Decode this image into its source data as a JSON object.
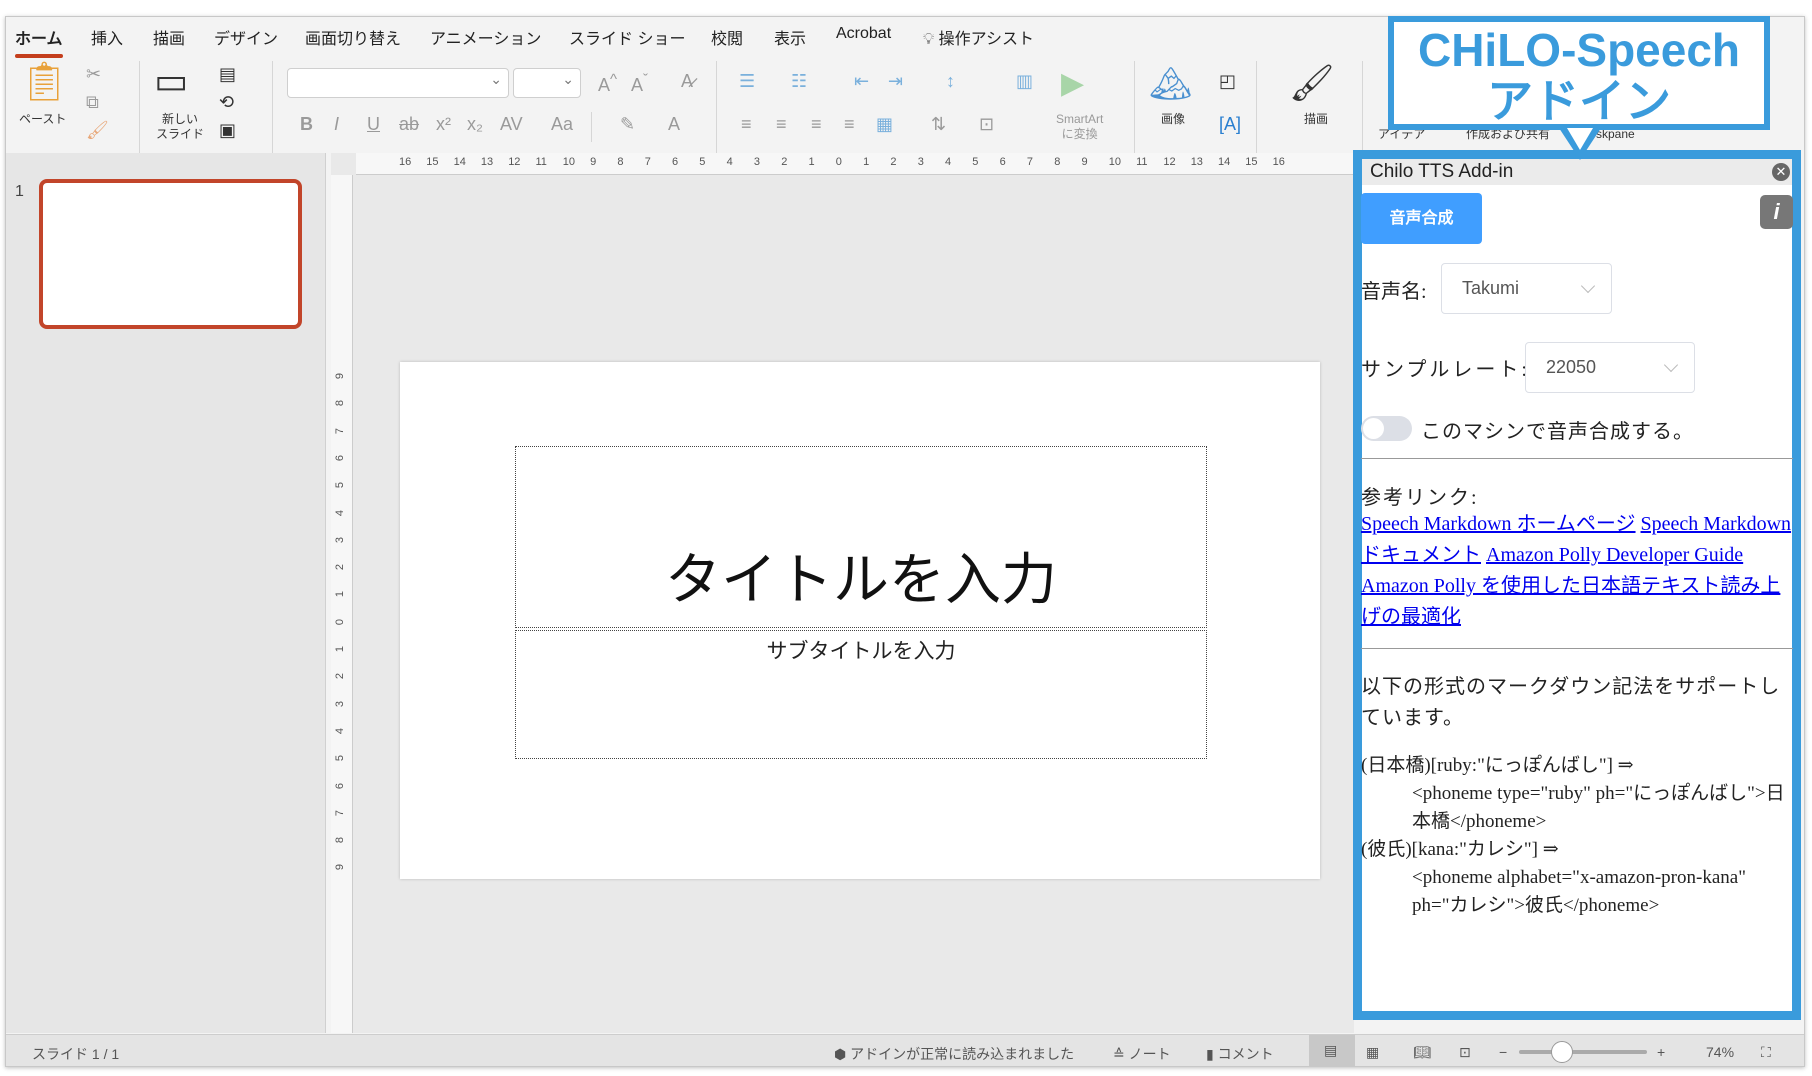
{
  "tabs": [
    "ホーム",
    "挿入",
    "描画",
    "デザイン",
    "画面切り替え",
    "アニメーション",
    "スライド ショー",
    "校閲",
    "表示",
    "Acrobat",
    "操作アシスト"
  ],
  "ribbon": {
    "paste": "ペースト",
    "new_slide": "新しい\nスライド",
    "smartart": "SmartArt\nに変換",
    "image": "画像",
    "draw": "描画",
    "ideas": "アイデア",
    "create_share": "作成および共有",
    "taskpane": "skpane",
    "font_name": "",
    "font_size": ""
  },
  "ruler": {
    "h": [
      "16",
      "15",
      "14",
      "13",
      "12",
      "11",
      "10",
      "9",
      "8",
      "7",
      "6",
      "5",
      "4",
      "3",
      "2",
      "1",
      "0",
      "1",
      "2",
      "3",
      "4",
      "5",
      "6",
      "7",
      "8",
      "9",
      "10",
      "11",
      "12",
      "13",
      "14",
      "15",
      "16"
    ],
    "v": [
      "9",
      "8",
      "7",
      "6",
      "5",
      "4",
      "3",
      "2",
      "1",
      "0",
      "1",
      "2",
      "3",
      "4",
      "5",
      "6",
      "7",
      "8",
      "9"
    ]
  },
  "slides_panel": {
    "slide_number": "1"
  },
  "slide": {
    "title_placeholder": "タイトルを入力",
    "subtitle_placeholder": "サブタイトルを入力"
  },
  "status": {
    "slide_count": "スライド 1 / 1",
    "addin_msg": "アドインが正常に読み込まれました",
    "notes": "ノート",
    "comments": "コメント",
    "zoom_minus": "−",
    "zoom_plus": "+",
    "zoom": "74%",
    "zoom_value": 74
  },
  "callout": {
    "line1": "CHiLO-Speech",
    "line2": "アドイン"
  },
  "pane": {
    "title": "Chilo TTS Add-in",
    "synth_button": "音声合成",
    "info_button": "i",
    "voice_label": "音声名:",
    "voice_value": "Takumi",
    "rate_label": "サンプルレート:",
    "rate_value": "22050",
    "local_toggle_label": "このマシンで音声合成する。",
    "local_toggle_on": false,
    "links_heading": "参考リンク:",
    "links": [
      "Speech Markdown ホームページ",
      "Speech Markdown ドキュメント",
      "Amazon Polly Developer Guide",
      "Amazon Polly を使用した日本語テキスト読み上げの最適化"
    ],
    "support_text": "以下の形式のマークダウン記法をサポートしています。",
    "examples": [
      {
        "input": "(日本橋)[ruby:\"にっぽんばし\"] ⇒",
        "output": "<phoneme type=\"ruby\" ph=\"にっぽんばし\">日本橋</phoneme>"
      },
      {
        "input": "(彼氏)[kana:\"カレシ\"] ⇒",
        "output": "<phoneme alphabet=\"x-amazon-pron-kana\" ph=\"カレシ\">彼氏</phoneme>"
      }
    ]
  },
  "colors": {
    "accent": "#c43e1c",
    "pane_border": "#3a9bdc",
    "button": "#409eff"
  }
}
